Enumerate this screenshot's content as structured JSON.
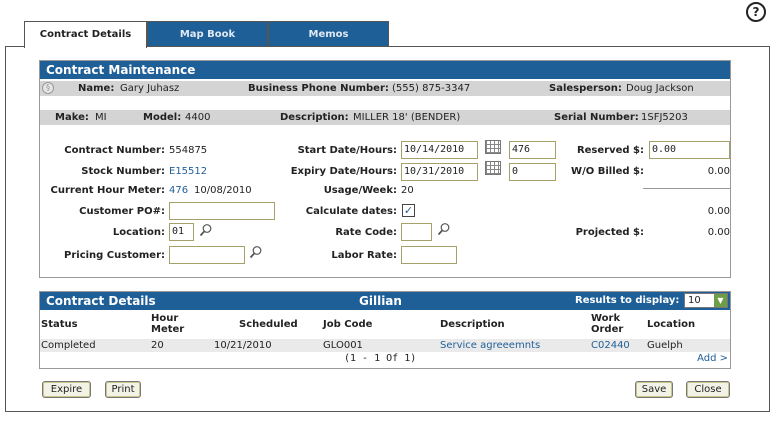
{
  "tabs": [
    {
      "label": "Contract Details"
    },
    {
      "label": "Map Book"
    },
    {
      "label": "Memos"
    }
  ],
  "help_symbol": "?",
  "contract_maintenance": {
    "title": "Contract Maintenance",
    "customer_strip": {
      "name_label": "Name:",
      "name_value": "Gary Juhasz",
      "phone_label": "Business Phone Number:",
      "phone_value": "(555) 875-3347",
      "sales_label": "Salesperson:",
      "sales_value": "Doug Jackson"
    },
    "equipment_strip": {
      "make_label": "Make:",
      "make_value": "MI",
      "model_label": "Model:",
      "model_value": "4400",
      "desc_label": "Description:",
      "desc_value": "MILLER 18' (BENDER)",
      "serial_label": "Serial Number:",
      "serial_value": "1SFJ5203"
    },
    "contract_number_label": "Contract Number:",
    "contract_number": "554875",
    "stock_number_label": "Stock Number:",
    "stock_number": "E15512",
    "hour_meter_label": "Current Hour Meter:",
    "hour_meter": "476",
    "hour_meter_date": "10/08/2010",
    "customer_po_label": "Customer PO#:",
    "customer_po": "",
    "location_label": "Location:",
    "location": "01",
    "pricing_customer_label": "Pricing Customer:",
    "pricing_customer": "",
    "start_label": "Start Date/Hours:",
    "start_date": "10/14/2010",
    "start_hours": "476",
    "expiry_label": "Expiry Date/Hours:",
    "expiry_date": "10/31/2010",
    "expiry_hours": "0",
    "usage_label": "Usage/Week:",
    "usage": "20",
    "calc_dates_label": "Calculate dates:",
    "calc_dates_checked": "✓",
    "rate_code_label": "Rate Code:",
    "rate_code": "",
    "labor_rate_label": "Labor Rate:",
    "labor_rate": "",
    "reserved_label": "Reserved $:",
    "reserved": "0.00",
    "wo_billed_label": "W/O Billed $:",
    "wo_billed": "0.00",
    "subtotal": "0.00",
    "projected_label": "Projected $:",
    "projected": "0.00"
  },
  "contract_details": {
    "title": "Contract Details",
    "tech": "Gillian",
    "results_label": "Results to display:",
    "results_value": "10",
    "columns": {
      "status": "Status",
      "hour_meter_1": "Hour",
      "hour_meter_2": "Meter",
      "scheduled": "Scheduled",
      "job_code": "Job Code",
      "description": "Description",
      "work_order_1": "Work",
      "work_order_2": "Order",
      "location": "Location"
    },
    "rows": [
      {
        "status": "Completed",
        "hour_meter": "20",
        "scheduled": "10/21/2010",
        "job_code": "GLO001",
        "description": "Service agreeemnts",
        "work_order": "C02440",
        "location": "Guelph"
      }
    ],
    "pagination": "(1 - 1 Of 1)",
    "add_link": "Add >"
  },
  "buttons": {
    "expire": "Expire",
    "print": "Print",
    "save": "Save",
    "close": "Close"
  },
  "colors": {
    "header_blue": "#1f5f98",
    "strip_gray": "#d4d4d4",
    "row_gray": "#eaeaea",
    "link_blue": "#1f5f98"
  }
}
